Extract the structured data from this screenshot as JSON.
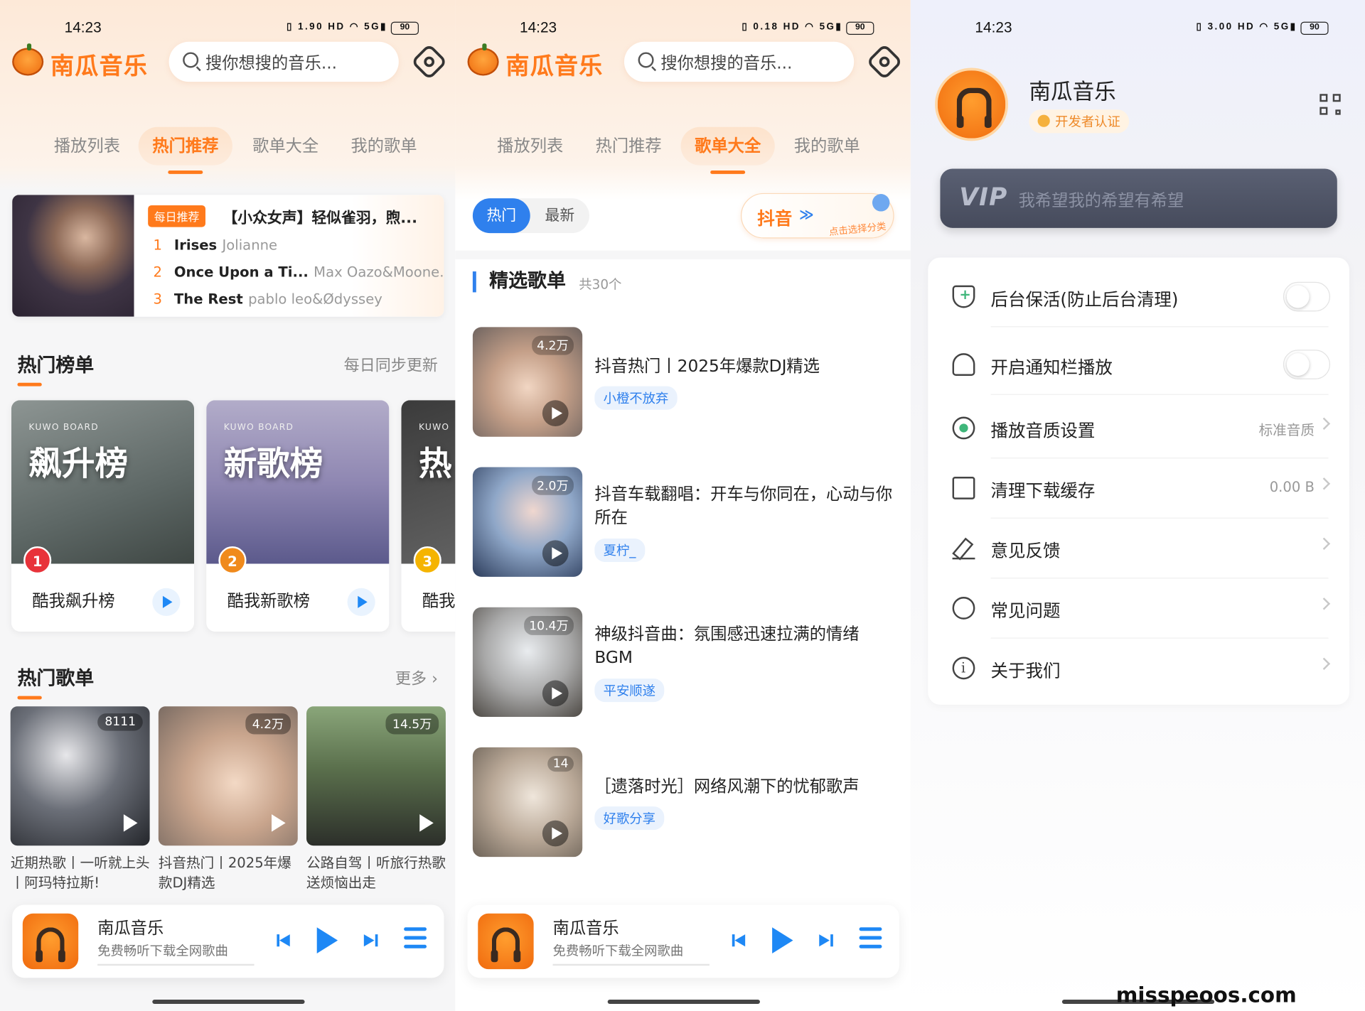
{
  "status": {
    "s1": {
      "time": "14:23",
      "speed": "1.90",
      "battery": "90"
    },
    "s2": {
      "time": "14:23",
      "speed": "0.18",
      "battery": "90"
    },
    "s3": {
      "time": "14:23",
      "speed": "3.00",
      "battery": "90"
    }
  },
  "app": {
    "brand": "南瓜音乐",
    "search_placeholder": "搜你想搜的音乐..."
  },
  "tabs": [
    "播放列表",
    "热门推荐",
    "歌单大全",
    "我的歌单"
  ],
  "daily": {
    "badge": "每日推荐",
    "title": "【小众女声】轻似雀羽，煦...",
    "songs": [
      {
        "n": "1",
        "title": "Irises",
        "artist": "Jolianne"
      },
      {
        "n": "2",
        "title": "Once Upon a Ti...",
        "artist": "Max Oazo&Moone..."
      },
      {
        "n": "3",
        "title": "The Rest",
        "artist": "pablo leo&Ødyssey"
      }
    ]
  },
  "charts": {
    "title": "热门榜单",
    "right": "每日同步更新",
    "items": [
      {
        "brand": "KUWO BOARD",
        "big": "飙升榜",
        "rank": "1",
        "name": "酷我飙升榜"
      },
      {
        "brand": "KUWO BOARD",
        "big": "新歌榜",
        "rank": "2",
        "name": "酷我新歌榜"
      },
      {
        "brand": "KUWO",
        "big": "热",
        "rank": "3",
        "name": "酷我"
      }
    ]
  },
  "hot_playlists": {
    "title": "热门歌单",
    "more": "更多 ›",
    "items": [
      {
        "count": "8111",
        "caption": "近期热歌丨一听就上头丨阿玛特拉斯!"
      },
      {
        "count": "4.2万",
        "caption": "抖音热门丨2025年爆款DJ精选"
      },
      {
        "count": "14.5万",
        "caption": "公路自驾丨听旅行热歌送烦恼出走"
      }
    ]
  },
  "player": {
    "title": "南瓜音乐",
    "subtitle": "免费畅听下载全网歌曲"
  },
  "screen2": {
    "seg_on": "热门",
    "seg_off": "最新",
    "category": {
      "label": "抖音",
      "chevron": "≫",
      "hint": "点击选择分类"
    },
    "section": {
      "title": "精选歌单",
      "count": "共30个"
    },
    "rows": [
      {
        "count": "4.2万",
        "name": "抖音热门丨2025年爆款DJ精选",
        "tag": "小橙不放弃"
      },
      {
        "count": "2.0万",
        "name": "抖音车载翻唱：开车与你同在，心动与你所在",
        "tag": "夏柠_"
      },
      {
        "count": "10.4万",
        "name": "神级抖音曲：氛围感迅速拉满的情绪BGM",
        "tag": "平安顺遂"
      },
      {
        "count": "14",
        "name": "［遗落时光］网络风潮下的忧郁歌声",
        "tag": "好歌分享"
      }
    ]
  },
  "screen3": {
    "name": "南瓜音乐",
    "dev": "开发者认证",
    "vip_logo": "VIP",
    "vip_text": "我希望我的希望有希望",
    "settings": [
      {
        "label": "后台保活(防止后台清理)",
        "value": ""
      },
      {
        "label": "开启通知栏播放",
        "value": ""
      },
      {
        "label": "播放音质设置",
        "value": "标准音质"
      },
      {
        "label": "清理下载缓存",
        "value": "0.00 B"
      },
      {
        "label": "意见反馈",
        "value": ""
      },
      {
        "label": "常见问题",
        "value": ""
      },
      {
        "label": "关于我们",
        "value": ""
      }
    ]
  },
  "watermark": "misspeoos.com"
}
